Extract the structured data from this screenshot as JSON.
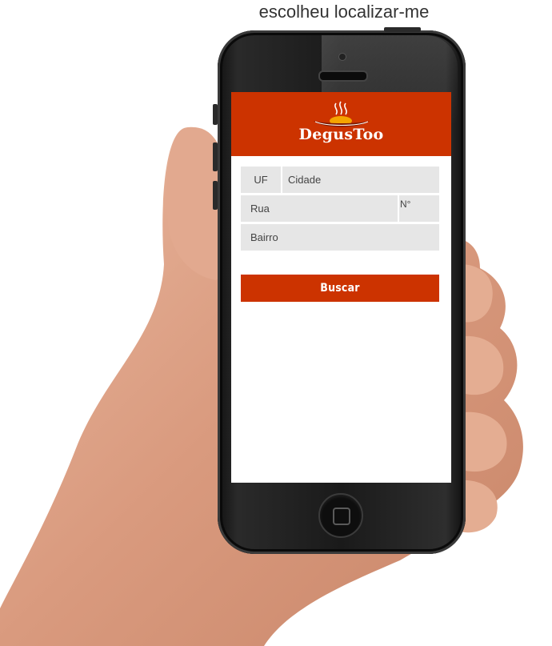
{
  "caption": "escolheu localizar-me",
  "app": {
    "brand": "DegusToo",
    "colors": {
      "accent": "#cc3300",
      "field_bg": "#e6e6e6"
    }
  },
  "form": {
    "uf_placeholder": "UF",
    "cidade_placeholder": "Cidade",
    "rua_placeholder": "Rua",
    "numero_label": "N°",
    "bairro_placeholder": "Bairro",
    "search_button": "Buscar"
  },
  "icons": {
    "logo": "steaming-dish-icon",
    "home": "home-button-icon"
  }
}
